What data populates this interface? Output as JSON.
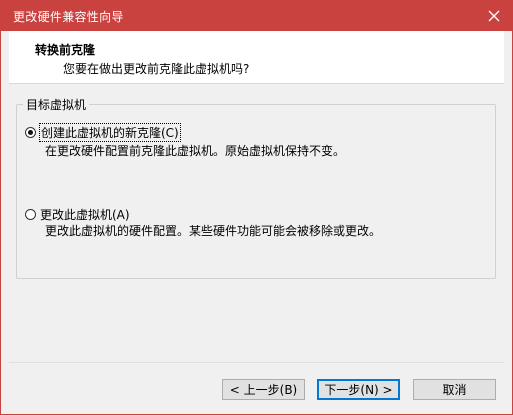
{
  "window": {
    "title": "更改硬件兼容性向导",
    "accent_color": "#c9423f",
    "close_icon": "close-icon"
  },
  "header": {
    "title": "转换前克隆",
    "subtitle": "您要在做出更改前克隆此虚拟机吗?"
  },
  "group": {
    "label": "目标虚拟机",
    "options": [
      {
        "label": "创建此虚拟机的新克隆(C)",
        "description": "在更改硬件配置前克隆此虚拟机。原始虚拟机保持不变。",
        "selected": true
      },
      {
        "label": "更改此虚拟机(A)",
        "description": "更改此虚拟机的硬件配置。某些硬件功能可能会被移除或更改。",
        "selected": false
      }
    ]
  },
  "buttons": {
    "back": "< 上一步(B)",
    "next": "下一步(N) >",
    "cancel": "取消"
  }
}
